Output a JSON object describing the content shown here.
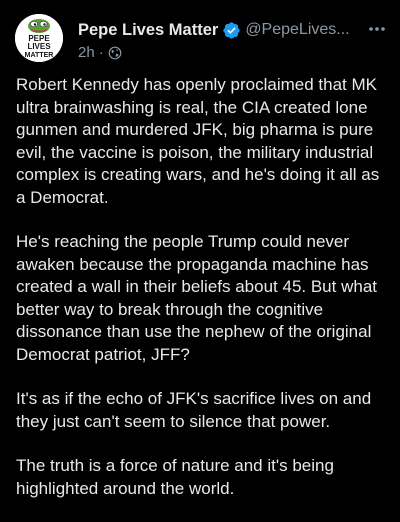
{
  "post": {
    "author": {
      "display_name": "Pepe Lives Matter",
      "handle": "@PepeLives...",
      "avatar_text": "PEPE LIVES MATTER"
    },
    "timestamp": "2h",
    "separator": "·",
    "paragraphs": [
      "Robert Kennedy has openly proclaimed that MK ultra brainwashing is real, the CIA created lone gunmen and murdered JFK, big pharma is pure evil, the vaccine is poison, the military industrial complex is creating wars, and he's doing it all as a Democrat.",
      "He's reaching the people Trump could never awaken because the propaganda machine has created a wall in their beliefs about 45. But what better way to break through the cognitive dissonance than use the nephew of the original Democrat patriot, JFF?",
      "It's as if the echo of JFK's sacrifice lives on and they just can't seem to silence that power.",
      "The truth is a force of nature and it's being highlighted around the world."
    ]
  },
  "colors": {
    "background": "#000000",
    "text": "#e7e9ea",
    "secondary": "#8b98a5",
    "verified": "#1d9bf0",
    "pepe_green": "#5aa038"
  },
  "icons": [
    "verified-badge-icon",
    "globe-icon",
    "more-options-icon"
  ]
}
